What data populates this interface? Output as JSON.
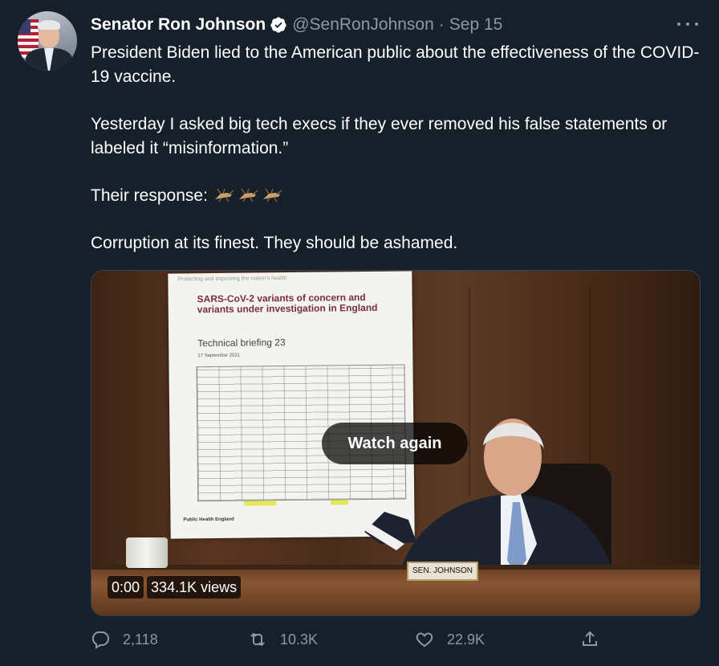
{
  "tweet": {
    "author": {
      "name": "Senator Ron Johnson",
      "handle": "@SenRonJohnson",
      "separator": "·",
      "date": "Sep 15"
    },
    "text": {
      "line1": "President Biden lied to the American public about the effectiveness of the COVID-19 vaccine.",
      "line2": "Yesterday I asked big tech execs if they ever removed his false statements or labeled it “misinformation.”",
      "line3_prefix": "Their response: ",
      "line4": "Corruption at its finest. They should be ashamed."
    },
    "icons": {
      "verified": "verified-badge-icon",
      "more": "more-options-icon",
      "emoji": "cricket-emoji-icon",
      "reply": "reply-icon",
      "retweet": "retweet-icon",
      "like": "like-icon",
      "share": "share-icon"
    },
    "media": {
      "watch_again_label": "Watch again",
      "time": "0:00",
      "views": "334.1K views",
      "poster_top": "Protecting and improving the nation's health",
      "poster_title": "SARS-CoV-2 variants of concern and variants under investigation in England",
      "poster_subtitle": "Technical briefing 23",
      "poster_date": "17 September 2021",
      "poster_footer": "Public Health England",
      "nameplate": "SEN. JOHNSON"
    },
    "actions": {
      "replies": "2,118",
      "retweets": "10.3K",
      "likes": "22.9K"
    },
    "colors": {
      "background": "#15202b",
      "text_primary": "#ffffff",
      "text_secondary": "#8b98a5",
      "verified": "#ffffff"
    }
  }
}
